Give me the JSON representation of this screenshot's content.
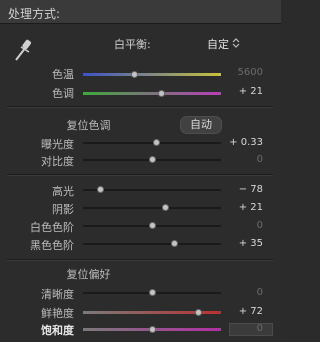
{
  "panel": {
    "title": "处理方式:"
  },
  "white_balance": {
    "label": "白平衡:",
    "value": "自定"
  },
  "sliders_wb": [
    {
      "label": "色温",
      "value": "5600",
      "level": 0.37
    },
    {
      "label": "色调",
      "value": "+ 21",
      "level": 0.57
    }
  ],
  "tone": {
    "reset_label": "复位色调",
    "auto_label": "自动",
    "sliders_a": [
      {
        "label": "曝光度",
        "value": "+ 0.33",
        "level": 0.53
      },
      {
        "label": "对比度",
        "value": "0",
        "level": 0.5
      }
    ],
    "sliders_b": [
      {
        "label": "高光",
        "value": "− 78",
        "level": 0.13
      },
      {
        "label": "阴影",
        "value": "+ 21",
        "level": 0.6
      },
      {
        "label": "白色色阶",
        "value": "0",
        "level": 0.5
      },
      {
        "label": "黑色色阶",
        "value": "+ 35",
        "level": 0.66
      }
    ]
  },
  "presence": {
    "reset_label": "复位偏好",
    "sliders": [
      {
        "label": "清晰度",
        "value": "0",
        "level": 0.5
      },
      {
        "label": "鲜艳度",
        "value": "+ 72",
        "level": 0.84
      },
      {
        "label": "饱和度",
        "value": "0",
        "level": 0.5
      }
    ]
  },
  "colors": {
    "temp_gradient": [
      "#3b53c8",
      "#c8c23a"
    ],
    "tint_gradient": [
      "#3fa83f",
      "#b83fb8"
    ],
    "vibrance_gradient": [
      "#7a7a7a",
      "#b83232"
    ],
    "saturation_gradient": [
      "#7a7a7a",
      "#b32fa3"
    ]
  }
}
